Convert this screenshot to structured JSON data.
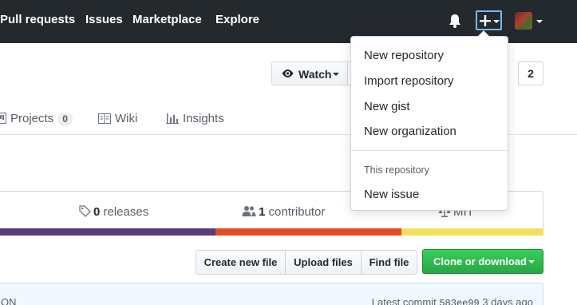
{
  "header": {
    "nav": [
      "Pull requests",
      "Issues",
      "Marketplace",
      "Explore"
    ],
    "icons": [
      "bell-icon",
      "plus-icon",
      "avatar"
    ]
  },
  "repo_actions": {
    "watch_label": "Watch",
    "count": "2"
  },
  "tabs": {
    "projects_label": "Projects",
    "projects_count": "0",
    "wiki_label": "Wiki",
    "insights_label": "Insights"
  },
  "summary": {
    "releases_count": "0",
    "releases_label": "releases",
    "contributors_count": "1",
    "contributors_label": "contributor",
    "license_partial": "MIT"
  },
  "language_bar": [
    {
      "color": "#563d7c",
      "fraction": 0.4
    },
    {
      "color": "#e34c26",
      "fraction": 0.34
    },
    {
      "color": "#f1e05a",
      "fraction": 0.26
    }
  ],
  "file_actions": {
    "create": "Create new file",
    "upload": "Upload files",
    "find": "Find file",
    "clone": "Clone or download"
  },
  "commit_bar": {
    "left_fragment": "ON",
    "latest_label": "Latest commit",
    "sha": "583ee99",
    "age": "3 days ago"
  },
  "dropdown": {
    "items": [
      "New repository",
      "Import repository",
      "New gist",
      "New organization"
    ],
    "section_header": "This repository",
    "section_items": [
      "New issue"
    ]
  },
  "colors": {
    "header_bg": "#24292e",
    "accent_focus": "#79b8ff",
    "green": "#28a745"
  }
}
